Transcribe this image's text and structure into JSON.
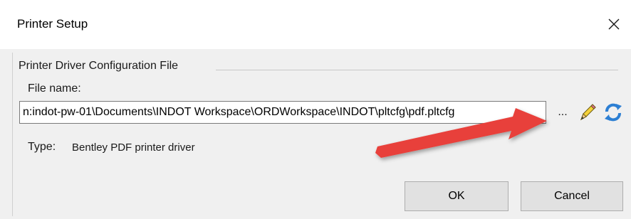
{
  "window": {
    "title": "Printer Setup",
    "close_icon": "close-icon"
  },
  "group": {
    "title": "Printer Driver Configuration File"
  },
  "file": {
    "label": "File name:",
    "value": "n:indot-pw-01\\Documents\\INDOT Workspace\\ORDWorkspace\\INDOT\\pltcfg\\pdf.pltcfg",
    "browse_label": "...",
    "edit_icon": "pencil-icon",
    "refresh_icon": "refresh-icon"
  },
  "type": {
    "label": "Type:",
    "value": "Bentley PDF printer driver"
  },
  "buttons": {
    "ok": "OK",
    "cancel": "Cancel"
  },
  "annotation": {
    "arrow_icon": "red-arrow-annotation",
    "color": "#e8403a"
  }
}
